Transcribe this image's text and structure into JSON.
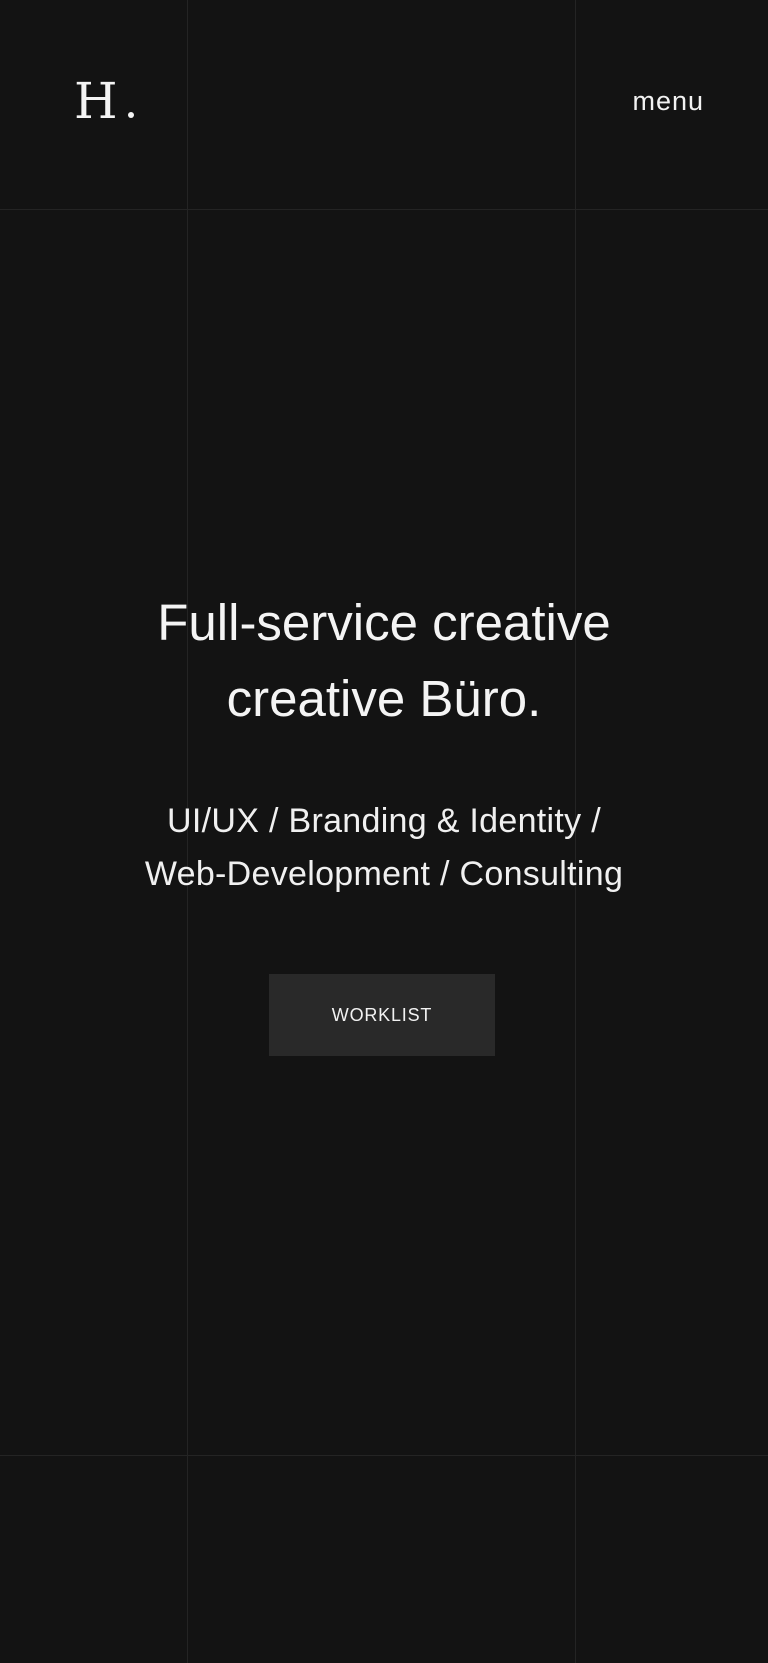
{
  "header": {
    "logo_text": "H",
    "menu_label": "menu"
  },
  "hero": {
    "title_line1": "Full-service creative",
    "title_line2": "creative Büro.",
    "services_line1": "UI/UX / Branding & Identity /",
    "services_line2": "Web-Development / Consulting",
    "cta_label": "WORKLIST"
  },
  "colors": {
    "background": "#131313",
    "grid_line": "#242424",
    "text": "#f2f2f2",
    "button_bg": "#292929"
  }
}
